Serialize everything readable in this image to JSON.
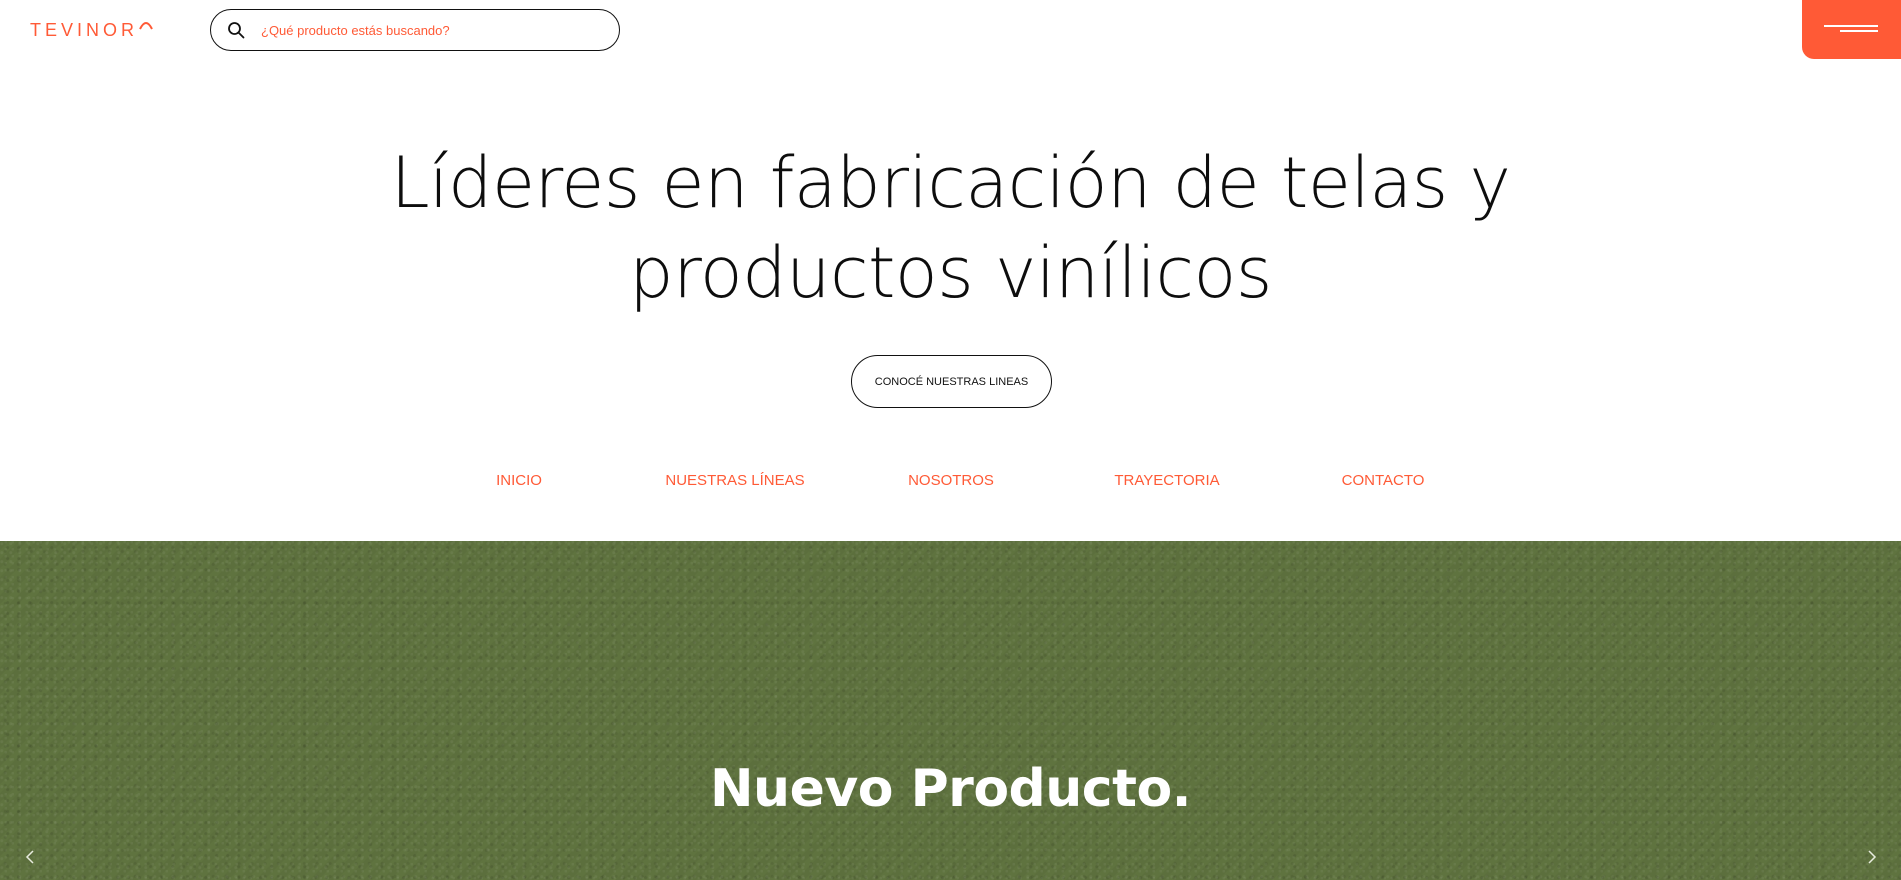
{
  "header": {
    "logo_text": "TEVINOR",
    "search_placeholder": "¿Qué producto estás buscando?",
    "accent_color": "#ff5a36"
  },
  "hero": {
    "title_line1": "Líderes en fabricación de telas y",
    "title_line2": "productos vinílicos",
    "cta_label": "CONOCÉ NUESTRAS LINEAS"
  },
  "nav": {
    "items": [
      {
        "label": "INICIO"
      },
      {
        "label": "NUESTRAS LÍNEAS"
      },
      {
        "label": "NOSOTROS"
      },
      {
        "label": "TRAYECTORIA"
      },
      {
        "label": "CONTACTO"
      }
    ]
  },
  "banner": {
    "title": "Nuevo Producto.",
    "background_color": "#5f733f"
  },
  "icons": {
    "search": "search-icon",
    "menu": "hamburger-menu-icon",
    "prev": "chevron-left-icon",
    "next": "chevron-right-icon"
  }
}
